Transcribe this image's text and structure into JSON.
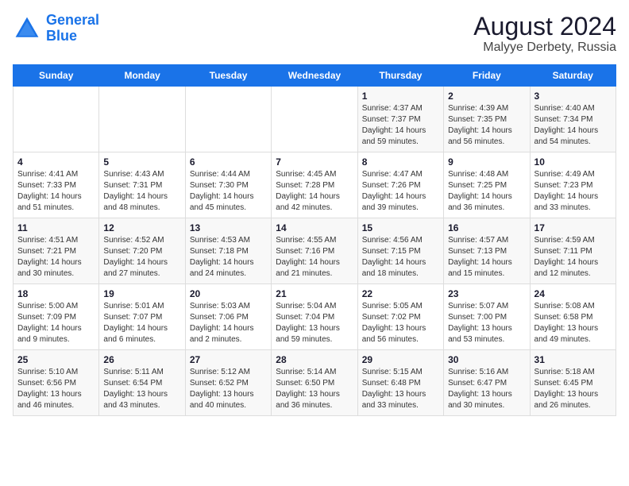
{
  "header": {
    "logo_line1": "General",
    "logo_line2": "Blue",
    "month_year": "August 2024",
    "location": "Malyye Derbety, Russia"
  },
  "days_of_week": [
    "Sunday",
    "Monday",
    "Tuesday",
    "Wednesday",
    "Thursday",
    "Friday",
    "Saturday"
  ],
  "weeks": [
    [
      {
        "day": "",
        "info": ""
      },
      {
        "day": "",
        "info": ""
      },
      {
        "day": "",
        "info": ""
      },
      {
        "day": "",
        "info": ""
      },
      {
        "day": "1",
        "info": "Sunrise: 4:37 AM\nSunset: 7:37 PM\nDaylight: 14 hours\nand 59 minutes."
      },
      {
        "day": "2",
        "info": "Sunrise: 4:39 AM\nSunset: 7:35 PM\nDaylight: 14 hours\nand 56 minutes."
      },
      {
        "day": "3",
        "info": "Sunrise: 4:40 AM\nSunset: 7:34 PM\nDaylight: 14 hours\nand 54 minutes."
      }
    ],
    [
      {
        "day": "4",
        "info": "Sunrise: 4:41 AM\nSunset: 7:33 PM\nDaylight: 14 hours\nand 51 minutes."
      },
      {
        "day": "5",
        "info": "Sunrise: 4:43 AM\nSunset: 7:31 PM\nDaylight: 14 hours\nand 48 minutes."
      },
      {
        "day": "6",
        "info": "Sunrise: 4:44 AM\nSunset: 7:30 PM\nDaylight: 14 hours\nand 45 minutes."
      },
      {
        "day": "7",
        "info": "Sunrise: 4:45 AM\nSunset: 7:28 PM\nDaylight: 14 hours\nand 42 minutes."
      },
      {
        "day": "8",
        "info": "Sunrise: 4:47 AM\nSunset: 7:26 PM\nDaylight: 14 hours\nand 39 minutes."
      },
      {
        "day": "9",
        "info": "Sunrise: 4:48 AM\nSunset: 7:25 PM\nDaylight: 14 hours\nand 36 minutes."
      },
      {
        "day": "10",
        "info": "Sunrise: 4:49 AM\nSunset: 7:23 PM\nDaylight: 14 hours\nand 33 minutes."
      }
    ],
    [
      {
        "day": "11",
        "info": "Sunrise: 4:51 AM\nSunset: 7:21 PM\nDaylight: 14 hours\nand 30 minutes."
      },
      {
        "day": "12",
        "info": "Sunrise: 4:52 AM\nSunset: 7:20 PM\nDaylight: 14 hours\nand 27 minutes."
      },
      {
        "day": "13",
        "info": "Sunrise: 4:53 AM\nSunset: 7:18 PM\nDaylight: 14 hours\nand 24 minutes."
      },
      {
        "day": "14",
        "info": "Sunrise: 4:55 AM\nSunset: 7:16 PM\nDaylight: 14 hours\nand 21 minutes."
      },
      {
        "day": "15",
        "info": "Sunrise: 4:56 AM\nSunset: 7:15 PM\nDaylight: 14 hours\nand 18 minutes."
      },
      {
        "day": "16",
        "info": "Sunrise: 4:57 AM\nSunset: 7:13 PM\nDaylight: 14 hours\nand 15 minutes."
      },
      {
        "day": "17",
        "info": "Sunrise: 4:59 AM\nSunset: 7:11 PM\nDaylight: 14 hours\nand 12 minutes."
      }
    ],
    [
      {
        "day": "18",
        "info": "Sunrise: 5:00 AM\nSunset: 7:09 PM\nDaylight: 14 hours\nand 9 minutes."
      },
      {
        "day": "19",
        "info": "Sunrise: 5:01 AM\nSunset: 7:07 PM\nDaylight: 14 hours\nand 6 minutes."
      },
      {
        "day": "20",
        "info": "Sunrise: 5:03 AM\nSunset: 7:06 PM\nDaylight: 14 hours\nand 2 minutes."
      },
      {
        "day": "21",
        "info": "Sunrise: 5:04 AM\nSunset: 7:04 PM\nDaylight: 13 hours\nand 59 minutes."
      },
      {
        "day": "22",
        "info": "Sunrise: 5:05 AM\nSunset: 7:02 PM\nDaylight: 13 hours\nand 56 minutes."
      },
      {
        "day": "23",
        "info": "Sunrise: 5:07 AM\nSunset: 7:00 PM\nDaylight: 13 hours\nand 53 minutes."
      },
      {
        "day": "24",
        "info": "Sunrise: 5:08 AM\nSunset: 6:58 PM\nDaylight: 13 hours\nand 49 minutes."
      }
    ],
    [
      {
        "day": "25",
        "info": "Sunrise: 5:10 AM\nSunset: 6:56 PM\nDaylight: 13 hours\nand 46 minutes."
      },
      {
        "day": "26",
        "info": "Sunrise: 5:11 AM\nSunset: 6:54 PM\nDaylight: 13 hours\nand 43 minutes."
      },
      {
        "day": "27",
        "info": "Sunrise: 5:12 AM\nSunset: 6:52 PM\nDaylight: 13 hours\nand 40 minutes."
      },
      {
        "day": "28",
        "info": "Sunrise: 5:14 AM\nSunset: 6:50 PM\nDaylight: 13 hours\nand 36 minutes."
      },
      {
        "day": "29",
        "info": "Sunrise: 5:15 AM\nSunset: 6:48 PM\nDaylight: 13 hours\nand 33 minutes."
      },
      {
        "day": "30",
        "info": "Sunrise: 5:16 AM\nSunset: 6:47 PM\nDaylight: 13 hours\nand 30 minutes."
      },
      {
        "day": "31",
        "info": "Sunrise: 5:18 AM\nSunset: 6:45 PM\nDaylight: 13 hours\nand 26 minutes."
      }
    ]
  ]
}
